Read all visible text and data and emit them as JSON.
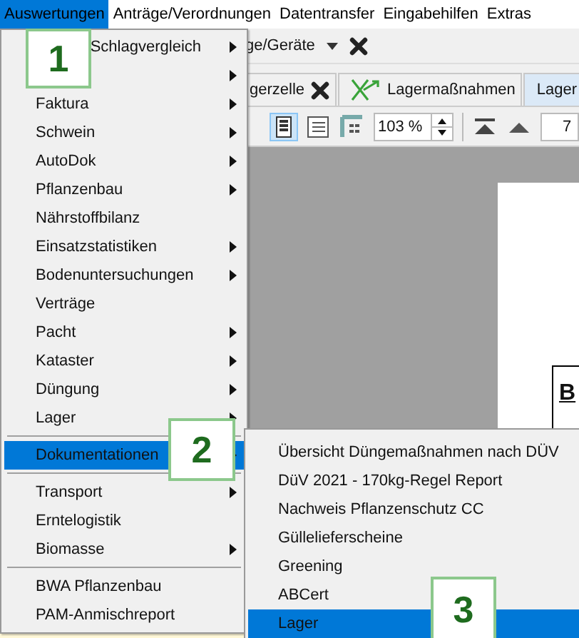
{
  "menubar": [
    {
      "label": "Auswertungen",
      "selected": true
    },
    {
      "label": "Anträge/Verordnungen",
      "selected": false
    },
    {
      "label": "Datentransfer",
      "selected": false
    },
    {
      "label": "Eingabehilfen",
      "selected": false
    },
    {
      "label": "Extras",
      "selected": false
    }
  ],
  "device_bar": {
    "field": "ge/Geräte"
  },
  "tabs": [
    {
      "label": "gerzelle",
      "kind": "closable",
      "selected": false
    },
    {
      "label": "Lagermaßnahmen",
      "kind": "icon",
      "selected": false
    },
    {
      "label": "Lager",
      "kind": "plain",
      "selected": true
    }
  ],
  "view_toolbar": {
    "zoom": "103 %",
    "page": "7"
  },
  "report_page": {
    "heading": "B"
  },
  "menu": {
    "items": [
      {
        "kind": "covered",
        "label": "Schlagvergleich",
        "submenu": true,
        "selected": false
      },
      {
        "kind": "item",
        "submenu": true,
        "selected": false
      },
      {
        "kind": "item",
        "label": "Faktura",
        "submenu": true,
        "selected": false
      },
      {
        "kind": "item",
        "label": "Schwein",
        "submenu": true,
        "selected": false
      },
      {
        "kind": "item",
        "label": "AutoDok",
        "submenu": true,
        "selected": false
      },
      {
        "kind": "item",
        "label": "Pflanzenbau",
        "submenu": true,
        "selected": false
      },
      {
        "kind": "item",
        "label": "Nährstoffbilanz",
        "submenu": false,
        "selected": false
      },
      {
        "kind": "item",
        "label": "Einsatzstatistiken",
        "submenu": true,
        "selected": false
      },
      {
        "kind": "item",
        "label": "Bodenuntersuchungen",
        "submenu": true,
        "selected": false
      },
      {
        "kind": "item",
        "label": "Verträge",
        "submenu": false,
        "selected": false
      },
      {
        "kind": "item",
        "label": "Pacht",
        "submenu": true,
        "selected": false
      },
      {
        "kind": "item",
        "label": "Kataster",
        "submenu": true,
        "selected": false
      },
      {
        "kind": "item",
        "label": "Düngung",
        "submenu": true,
        "selected": false
      },
      {
        "kind": "item",
        "label": "Lager",
        "submenu": true,
        "selected": false
      },
      {
        "kind": "separator"
      },
      {
        "kind": "item",
        "label": "Dokumentationen",
        "submenu": true,
        "selected": true
      },
      {
        "kind": "separator"
      },
      {
        "kind": "item",
        "label": "Transport",
        "submenu": true,
        "selected": false
      },
      {
        "kind": "item",
        "label": "Erntelogistik",
        "submenu": false,
        "selected": false
      },
      {
        "kind": "item",
        "label": "Biomasse",
        "submenu": true,
        "selected": false
      },
      {
        "kind": "separator"
      },
      {
        "kind": "item",
        "label": "BWA Pflanzenbau",
        "submenu": false,
        "selected": false
      },
      {
        "kind": "item",
        "label": "PAM-Anmischreport",
        "submenu": false,
        "selected": false
      }
    ]
  },
  "submenu": {
    "items": [
      {
        "label": "Übersicht Düngemaßnahmen nach DÜV",
        "selected": false
      },
      {
        "label": "DüV 2021 - 170kg-Regel Report",
        "selected": false
      },
      {
        "label": "Nachweis Pflanzenschutz CC",
        "selected": false
      },
      {
        "label": "Güllelieferscheine",
        "selected": false
      },
      {
        "label": "Greening",
        "selected": false
      },
      {
        "label": "ABCert",
        "selected": false
      },
      {
        "label": "Lager",
        "selected": true
      }
    ]
  },
  "callouts": [
    "1",
    "2",
    "3"
  ]
}
